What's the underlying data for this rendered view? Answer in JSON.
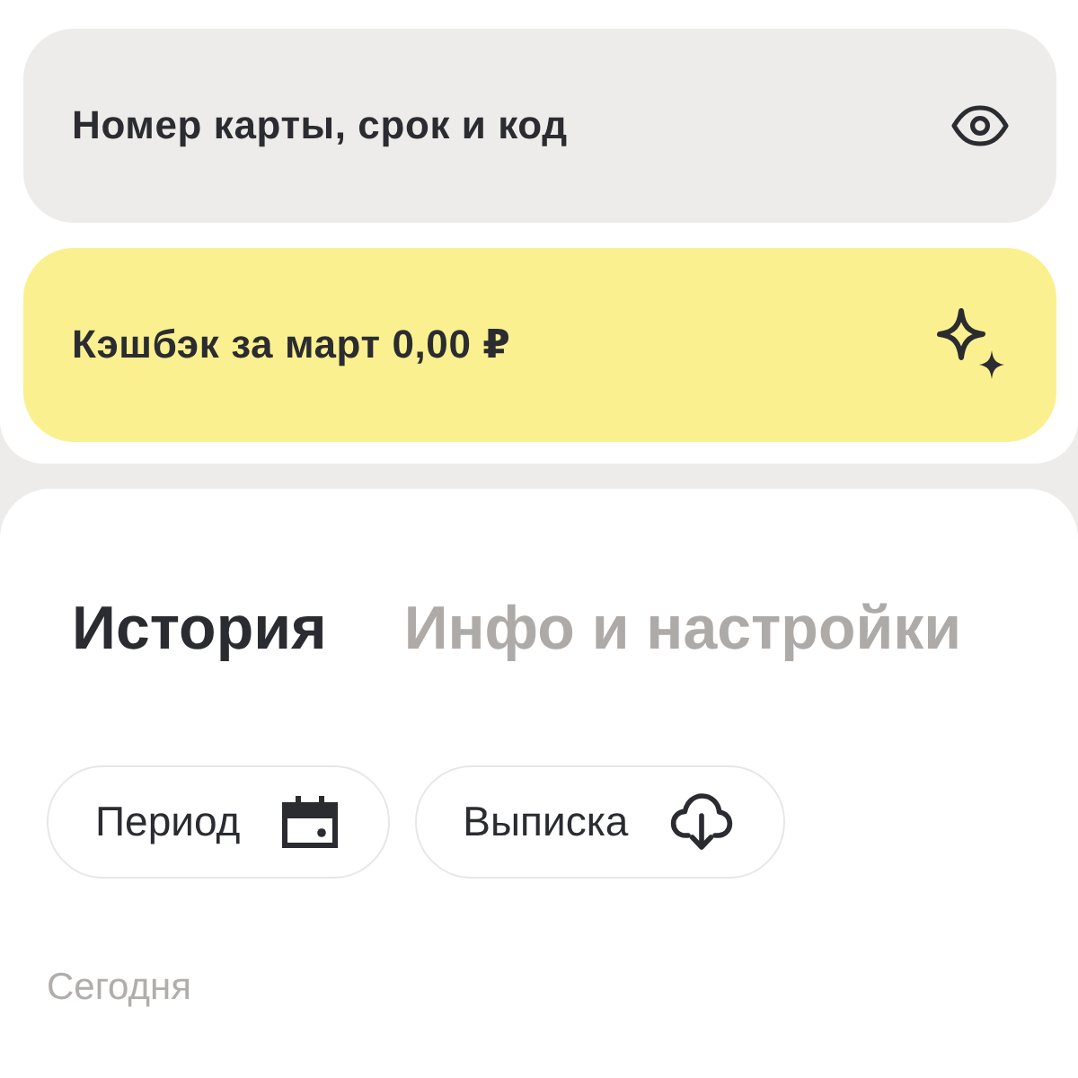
{
  "card_rows": [
    {
      "kind": "details",
      "label": "Номер карты, срок и код"
    },
    {
      "kind": "cashback",
      "label": "Кэшбэк за март 0,00 ₽"
    }
  ],
  "tabs": [
    {
      "label": "История",
      "selected": true
    },
    {
      "label": "Инфо и настройки",
      "selected": false
    }
  ],
  "filters": [
    {
      "kind": "period",
      "label": "Период"
    },
    {
      "kind": "statement",
      "label": "Выписка"
    }
  ],
  "history": {
    "section_label": "Сегодня"
  }
}
